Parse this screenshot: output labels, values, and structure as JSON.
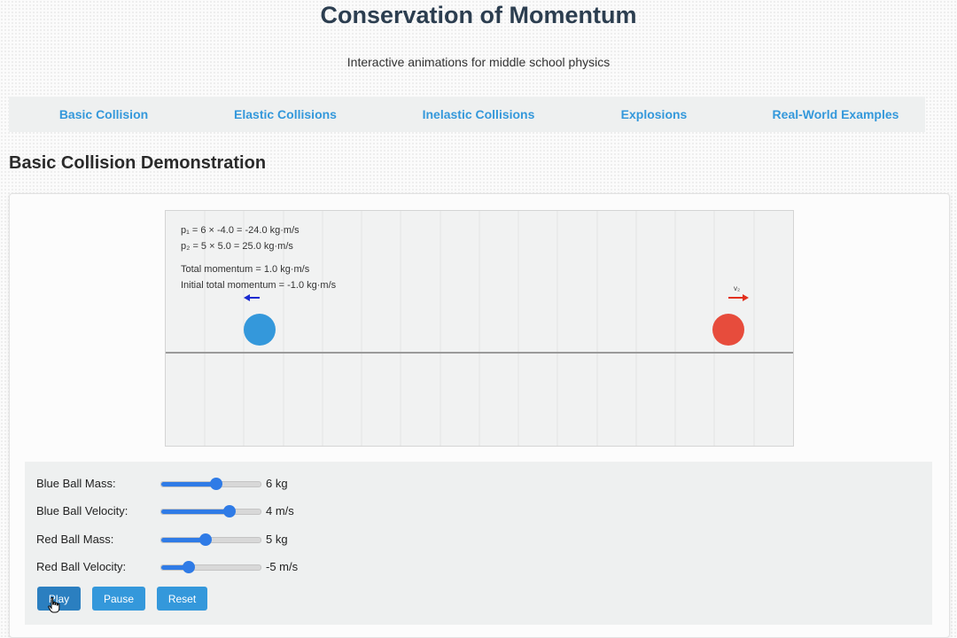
{
  "header": {
    "title": "Conservation of Momentum",
    "subtitle": "Interactive animations for middle school physics"
  },
  "nav": {
    "items": [
      {
        "label": "Basic Collision"
      },
      {
        "label": "Elastic Collisions"
      },
      {
        "label": "Inelastic Collisions"
      },
      {
        "label": "Explosions"
      },
      {
        "label": "Real-World Examples"
      }
    ]
  },
  "section": {
    "heading": "Basic Collision Demonstration"
  },
  "simulation": {
    "readouts": {
      "p1": "p₁ = 6 × -4.0 = -24.0 kg·m/s",
      "p2": "p₂ = 5 × 5.0 = 25.0 kg·m/s",
      "total": "Total momentum = 1.0 kg·m/s",
      "initial_total": "Initial total momentum = -1.0 kg·m/s"
    },
    "red_arrow_label": "v₂",
    "colors": {
      "blue_ball": "#3498db",
      "red_ball": "#e74c3c",
      "blue_arrow": "#1a2ad0",
      "red_arrow": "#e2301d"
    }
  },
  "controls": {
    "sliders": [
      {
        "label": "Blue Ball Mass:",
        "value_text": "6 kg",
        "fraction": 0.55
      },
      {
        "label": "Blue Ball Velocity:",
        "value_text": "4 m/s",
        "fraction": 0.69
      },
      {
        "label": "Red Ball Mass:",
        "value_text": "5 kg",
        "fraction": 0.45
      },
      {
        "label": "Red Ball Velocity:",
        "value_text": "-5 m/s",
        "fraction": 0.28
      }
    ],
    "buttons": {
      "play": "Play",
      "pause": "Pause",
      "reset": "Reset"
    }
  },
  "ui": {
    "accent": "#3498db",
    "slider_color": "#2f7be6",
    "title_color": "#2c3e50"
  }
}
